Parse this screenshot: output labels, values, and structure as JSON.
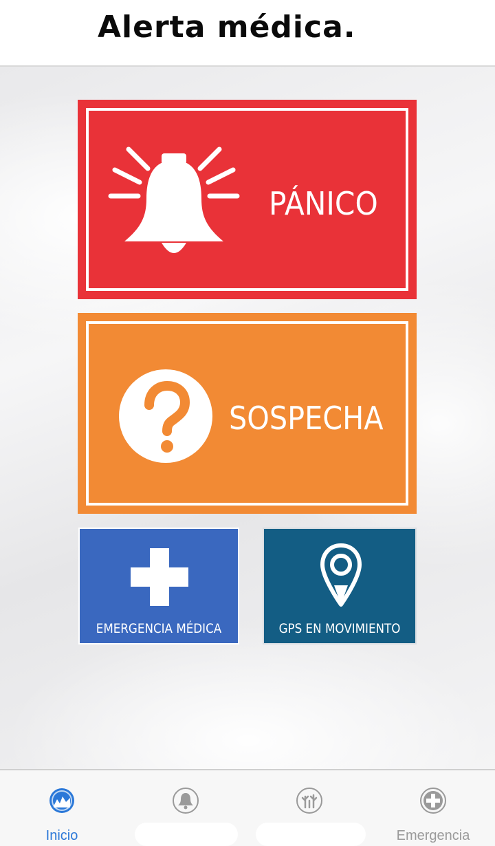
{
  "header": {
    "title": "Alerta médica."
  },
  "tiles": {
    "panic": {
      "label": "PÁNICO",
      "icon": "bell-icon",
      "color": "#e93238"
    },
    "suspicion": {
      "label": "SOSPECHA",
      "icon": "question-icon",
      "color": "#f28a34"
    },
    "medical": {
      "label": "EMERGENCIA MÉDICA",
      "icon": "medical-cross-icon",
      "color": "#3a68bf"
    },
    "gps": {
      "label": "GPS EN MOVIMIENTO",
      "icon": "map-pin-icon",
      "color": "#135d84"
    }
  },
  "tabbar": {
    "active_color": "#2b78d8",
    "tabs": [
      {
        "label": "Inicio",
        "icon": "home-icon",
        "active": true
      },
      {
        "label": "",
        "icon": "bell-icon",
        "active": false
      },
      {
        "label": "",
        "icon": "tree-icon",
        "active": false
      },
      {
        "label": "Emergencia",
        "icon": "medical-cross-icon",
        "active": false
      }
    ]
  }
}
